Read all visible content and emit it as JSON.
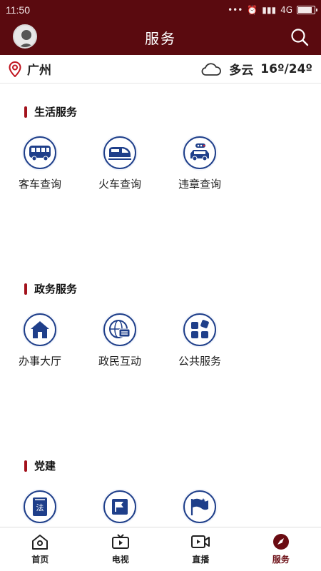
{
  "status_bar": {
    "time": "11:50",
    "network": "4G",
    "battery_level": 0.8
  },
  "header": {
    "title": "服务"
  },
  "location": {
    "city": "广州",
    "weather_condition": "多云",
    "temperature": "16º/24º"
  },
  "sections": [
    {
      "title": "生活服务",
      "items": [
        {
          "label": "客车查询",
          "icon": "bus-icon"
        },
        {
          "label": "火车查询",
          "icon": "train-icon"
        },
        {
          "label": "违章查询",
          "icon": "car-violation-icon"
        }
      ]
    },
    {
      "title": "政务服务",
      "items": [
        {
          "label": "办事大厅",
          "icon": "home-icon"
        },
        {
          "label": "政民互动",
          "icon": "globe-chat-icon"
        },
        {
          "label": "公共服务",
          "icon": "grid-apps-icon"
        }
      ]
    },
    {
      "title": "党建",
      "items": [
        {
          "label": "",
          "icon": "law-book-icon"
        },
        {
          "label": "",
          "icon": "flag-board-icon"
        },
        {
          "label": "",
          "icon": "party-flag-icon"
        }
      ]
    }
  ],
  "bottom_nav": [
    {
      "label": "首页",
      "icon": "home-nav-icon"
    },
    {
      "label": "电视",
      "icon": "tv-icon"
    },
    {
      "label": "直播",
      "icon": "live-video-icon"
    },
    {
      "label": "服务",
      "icon": "compass-icon",
      "active": true
    }
  ],
  "colors": {
    "brand": "#5a0a0f",
    "accent": "#a3121c",
    "icon_blue": "#1f3f8a"
  }
}
